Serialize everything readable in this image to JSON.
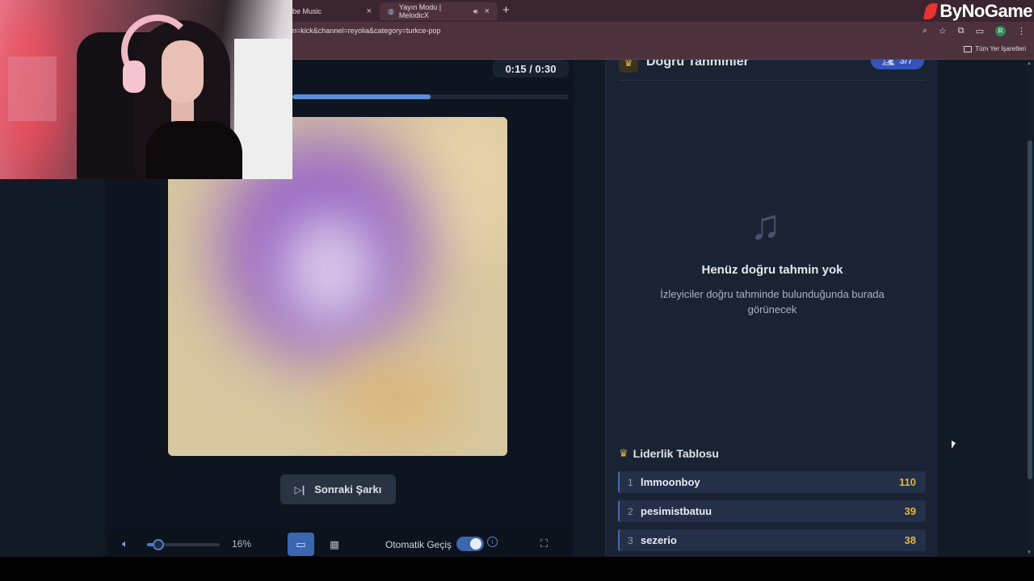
{
  "browser": {
    "tabs": [
      {
        "label": "be Music",
        "close": "×"
      },
      {
        "label": "Yayın Modu | MelodicX",
        "close": "×"
      }
    ],
    "new_tab": "+",
    "url": "n=kick&channel=reyolia&category=turkce-pop",
    "bookmarks_label": "Tüm Yer İşaretleri",
    "profile_initial": "R"
  },
  "watermark": "ByNoGame",
  "player": {
    "time": "0:15 / 0:30",
    "progress": 0.5,
    "next_button": "Sonraki Şarkı",
    "volume_percent": "16%",
    "volume_level": 0.16,
    "auto_advance_label": "Otomatik Geçiş",
    "auto_advance_on": true
  },
  "guesses": {
    "title": "Doğru Tahminler",
    "count": "3/7",
    "empty_title": "Henüz doğru tahmin yok",
    "empty_subtitle": "İzleyiciler doğru tahminde bulunduğunda burada görünecek"
  },
  "leaderboard": {
    "title": "Liderlik Tablosu",
    "rows": [
      {
        "rank": "1",
        "name": "lmmoonboy",
        "score": "110"
      },
      {
        "rank": "2",
        "name": "pesimistbatuu",
        "score": "39"
      },
      {
        "rank": "3",
        "name": "sezerio",
        "score": "38"
      }
    ]
  },
  "colors": {
    "accent": "#3b66b0",
    "score": "#e3b640",
    "panel": "#1a2333"
  }
}
